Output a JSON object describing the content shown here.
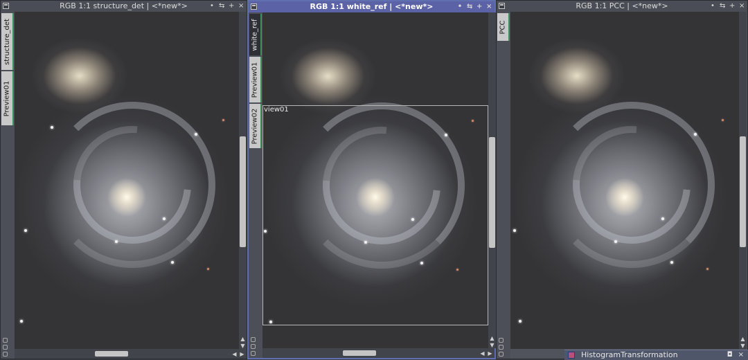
{
  "windows": [
    {
      "title": "RGB 1:1 structure_det | <*new*>",
      "active": false,
      "tabs": [
        "structure_det",
        "Preview01"
      ]
    },
    {
      "title": "RGB 1:1 white_ref | <*new*>",
      "active": true,
      "tabs": [
        "white_ref",
        "Preview01",
        "Preview02"
      ],
      "preview_label": "view01"
    },
    {
      "title": "RGB 1:1 PCC | <*new*>",
      "active": false,
      "tabs": [
        "PCC"
      ]
    }
  ],
  "title_buttons": [
    "•",
    "⇆",
    "+",
    "×"
  ],
  "icons": {
    "system": "window-menu-icon",
    "scroll_up": "arrow-up-icon",
    "scroll_down": "arrow-down-icon",
    "scroll_left": "arrow-left-icon",
    "scroll_right": "arrow-right-icon"
  },
  "bottom_panel": {
    "label": "HistogramTransformation",
    "buttons": [
      "◘",
      "×"
    ]
  },
  "colors": {
    "active_title": "#5b62a6",
    "tab_accent": "#3e8f5c",
    "background": "#3a3d44"
  }
}
